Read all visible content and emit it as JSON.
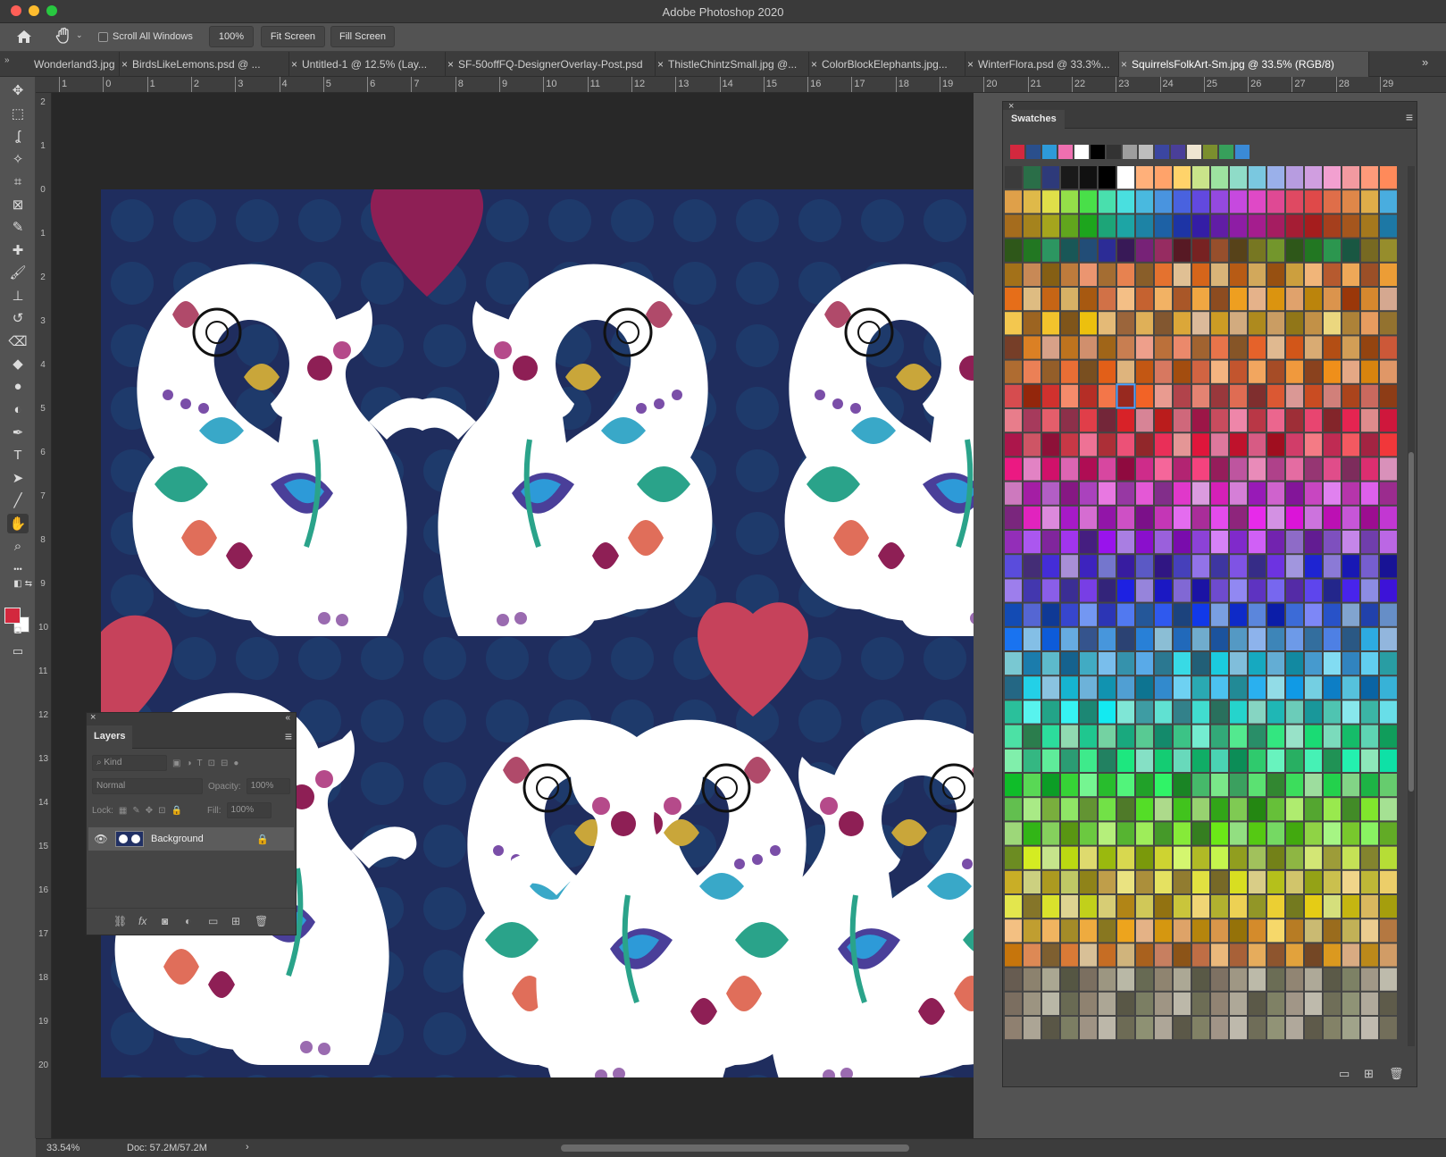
{
  "app": {
    "title": "Adobe Photoshop 2020"
  },
  "options_bar": {
    "scroll_all_label": "Scroll All Windows",
    "zoom_btn": "100%",
    "fit_btn": "Fit Screen",
    "fill_btn": "Fill Screen"
  },
  "tabs": [
    {
      "label": "Wonderland3.jpg",
      "active": false
    },
    {
      "label": "BirdsLikeLemons.psd @ ...",
      "active": false
    },
    {
      "label": "Untitled-1 @ 12.5% (Lay...",
      "active": false
    },
    {
      "label": "SF-50offFQ-DesignerOverlay-Post.psd",
      "active": false
    },
    {
      "label": "ThistleChintzSmall.jpg @...",
      "active": false
    },
    {
      "label": "ColorBlockElephants.jpg...",
      "active": false
    },
    {
      "label": "WinterFlora.psd @ 33.3%...",
      "active": false
    },
    {
      "label": "SquirrelsFolkArt-Sm.jpg @ 33.5% (RGB/8)",
      "active": true
    }
  ],
  "rulers": {
    "top": [
      "1",
      "0",
      "1",
      "2",
      "3",
      "4",
      "5",
      "6",
      "7",
      "8",
      "9",
      "10",
      "11",
      "12",
      "13",
      "14",
      "15",
      "16",
      "17",
      "18",
      "19",
      "20",
      "21",
      "22",
      "23",
      "24",
      "25",
      "26",
      "27",
      "28",
      "29"
    ],
    "left": [
      "2",
      "1",
      "0",
      "1",
      "2",
      "3",
      "4",
      "5",
      "6",
      "7",
      "8",
      "9",
      "10",
      "11",
      "12",
      "13",
      "14",
      "15",
      "16",
      "17",
      "18",
      "19",
      "20"
    ]
  },
  "tools": [
    {
      "name": "move-tool",
      "glyph": "✥"
    },
    {
      "name": "marquee-tool",
      "glyph": "⬚"
    },
    {
      "name": "lasso-tool",
      "glyph": "ʆ"
    },
    {
      "name": "magic-wand-tool",
      "glyph": "✧"
    },
    {
      "name": "crop-tool",
      "glyph": "⌗"
    },
    {
      "name": "frame-tool",
      "glyph": "⊠"
    },
    {
      "name": "eyedropper-tool",
      "glyph": "✎"
    },
    {
      "name": "healing-brush-tool",
      "glyph": "✚"
    },
    {
      "name": "brush-tool",
      "glyph": "🖌"
    },
    {
      "name": "clone-stamp-tool",
      "glyph": "⊥"
    },
    {
      "name": "history-brush-tool",
      "glyph": "↺"
    },
    {
      "name": "eraser-tool",
      "glyph": "⌫"
    },
    {
      "name": "paint-bucket-tool",
      "glyph": "◆"
    },
    {
      "name": "blur-tool",
      "glyph": "●"
    },
    {
      "name": "dodge-tool",
      "glyph": "◐"
    },
    {
      "name": "pen-tool",
      "glyph": "✒"
    },
    {
      "name": "type-tool",
      "glyph": "T"
    },
    {
      "name": "path-selection-tool",
      "glyph": "➤"
    },
    {
      "name": "line-tool",
      "glyph": "╱"
    },
    {
      "name": "hand-tool",
      "glyph": "✋",
      "active": true
    },
    {
      "name": "zoom-tool",
      "glyph": "⌕"
    },
    {
      "name": "more-tools",
      "glyph": "•••"
    }
  ],
  "colors": {
    "foreground": "#d3283e",
    "background": "#ffffff"
  },
  "swatches_panel": {
    "title": "Swatches",
    "recent": [
      "#d3283e",
      "#2a4f8c",
      "#2d9ad8",
      "#ee6fb0",
      "#ffffff",
      "#000000",
      "#333333",
      "#9e9e9e",
      "#bdbdbd",
      "#3b46a0",
      "#4a3f99",
      "#efe6d2",
      "#7b8f2e",
      "#37a05b",
      "#3a8ad6"
    ],
    "rows": 36,
    "cols": 21
  },
  "layers_panel": {
    "title": "Layers",
    "filter_label": "Kind",
    "blend_mode": "Normal",
    "opacity_label": "Opacity:",
    "opacity_value": "100%",
    "lock_label": "Lock:",
    "fill_label": "Fill:",
    "fill_value": "100%",
    "layers": [
      {
        "name": "Background",
        "visible": true,
        "locked": true
      }
    ]
  },
  "status_bar": {
    "zoom": "33.54%",
    "doc": "Doc: 57.2M/57.2M"
  }
}
